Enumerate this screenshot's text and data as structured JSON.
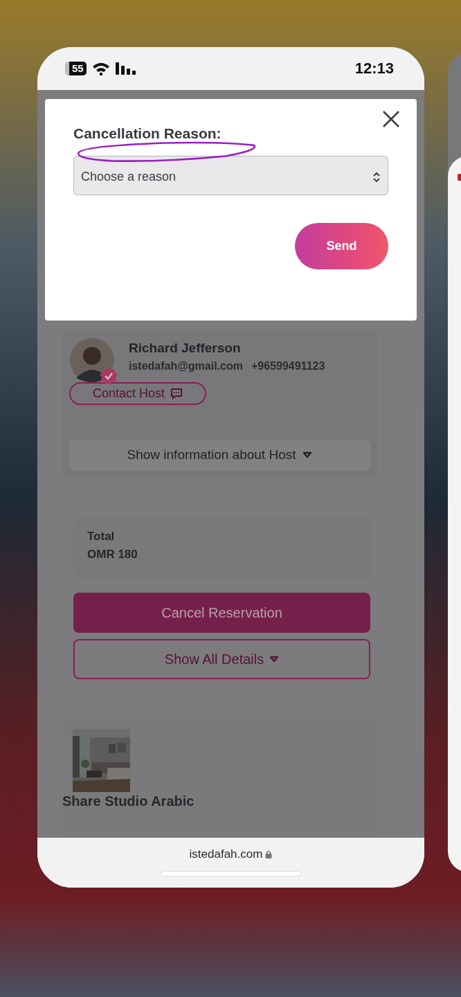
{
  "status_bar": {
    "battery": "55",
    "time": "12:13"
  },
  "modal": {
    "title": "Cancellation Reason:",
    "select": {
      "placeholder": "Choose a reason"
    },
    "send_button": "Send"
  },
  "host": {
    "name": "Richard Jefferson",
    "verified": true,
    "email": "istedafah@gmail.com",
    "phone": "+96599491123",
    "contact_button": "Contact Host",
    "info_button": "Show information about Host"
  },
  "total": {
    "label": "Total",
    "amount": "OMR 180"
  },
  "actions": [
    {
      "label": "Cancel Reservation",
      "kind": "filled"
    },
    {
      "label": "Show All Details",
      "kind": "outline"
    }
  ],
  "listing": {
    "title": "Share Studio Arabic"
  },
  "browser": {
    "url": "istedafah.com",
    "secure": true
  }
}
